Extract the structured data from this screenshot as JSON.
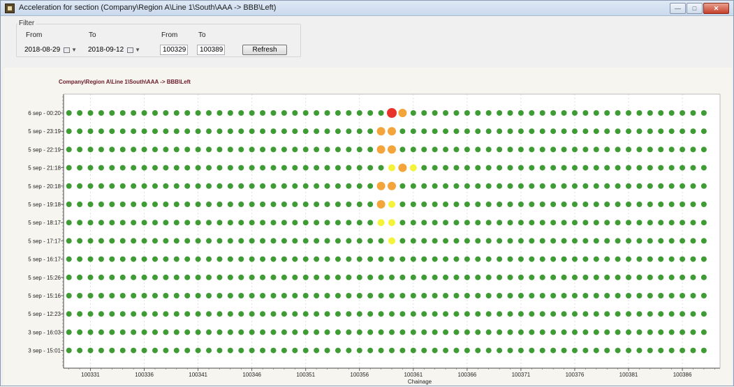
{
  "window": {
    "title": "Acceleration for section (Company\\Region A\\Line 1\\South\\AAA -> BBB\\Left)",
    "controls": [
      "minimize-icon",
      "maximize-icon",
      "close-icon"
    ]
  },
  "filter": {
    "legend": "Filter",
    "date_from_label": "From",
    "date_to_label": "To",
    "chain_from_label": "From",
    "chain_to_label": "To",
    "date_from": "2018-08-29",
    "date_to": "2018-09-12",
    "chain_from": "100329",
    "chain_to": "100389",
    "refresh_label": "Refresh"
  },
  "chart_data": {
    "type": "scatter",
    "title": "Company\\Region A\\Line 1\\South\\AAA -> BBB\\Left",
    "xlabel": "Chainage",
    "ylabel": "",
    "xlim": [
      100328.5,
      100389.5
    ],
    "x_ticks": [
      100331,
      100336,
      100341,
      100346,
      100351,
      100356,
      100361,
      100366,
      100371,
      100376,
      100381,
      100386
    ],
    "y_categories": [
      "3 sep - 15:01",
      "3 sep - 16:03",
      "5 sep - 12:23",
      "5 sep - 15:16",
      "5 sep - 15:26",
      "5 sep - 16:17",
      "5 sep - 17:17",
      "5 sep - 18:17",
      "5 sep - 19:18",
      "5 sep - 20:18",
      "5 sep - 21:18",
      "5 sep - 22:19",
      "5 sep - 23:19",
      "6 sep - 00:20"
    ],
    "grid": true,
    "colors": {
      "normal": "#3f9c35",
      "low": "#f5f23a",
      "medium": "#f3a43a",
      "high": "#e8322c"
    },
    "x_start": 100329,
    "x_step": 1,
    "x_count": 60,
    "rows": [
      {
        "time": "6 sep - 00:20",
        "highlights": [
          {
            "x": 100359,
            "level": "high"
          },
          {
            "x": 100360,
            "level": "medium"
          }
        ]
      },
      {
        "time": "5 sep - 23:19",
        "highlights": [
          {
            "x": 100358,
            "level": "medium"
          },
          {
            "x": 100359,
            "level": "medium"
          }
        ]
      },
      {
        "time": "5 sep - 22:19",
        "highlights": [
          {
            "x": 100358,
            "level": "medium"
          },
          {
            "x": 100359,
            "level": "medium"
          }
        ]
      },
      {
        "time": "5 sep - 21:18",
        "highlights": [
          {
            "x": 100359,
            "level": "low"
          },
          {
            "x": 100360,
            "level": "medium"
          },
          {
            "x": 100361,
            "level": "low"
          }
        ]
      },
      {
        "time": "5 sep - 20:18",
        "highlights": [
          {
            "x": 100358,
            "level": "medium"
          },
          {
            "x": 100359,
            "level": "medium"
          }
        ]
      },
      {
        "time": "5 sep - 19:18",
        "highlights": [
          {
            "x": 100358,
            "level": "medium"
          },
          {
            "x": 100359,
            "level": "low"
          }
        ]
      },
      {
        "time": "5 sep - 18:17",
        "highlights": [
          {
            "x": 100358,
            "level": "low"
          },
          {
            "x": 100359,
            "level": "low"
          }
        ]
      },
      {
        "time": "5 sep - 17:17",
        "highlights": [
          {
            "x": 100359,
            "level": "low"
          }
        ]
      },
      {
        "time": "5 sep - 16:17",
        "highlights": []
      },
      {
        "time": "5 sep - 15:26",
        "highlights": []
      },
      {
        "time": "5 sep - 15:16",
        "highlights": []
      },
      {
        "time": "5 sep - 12:23",
        "highlights": []
      },
      {
        "time": "3 sep - 16:03",
        "highlights": []
      },
      {
        "time": "3 sep - 15:01",
        "highlights": []
      }
    ]
  }
}
